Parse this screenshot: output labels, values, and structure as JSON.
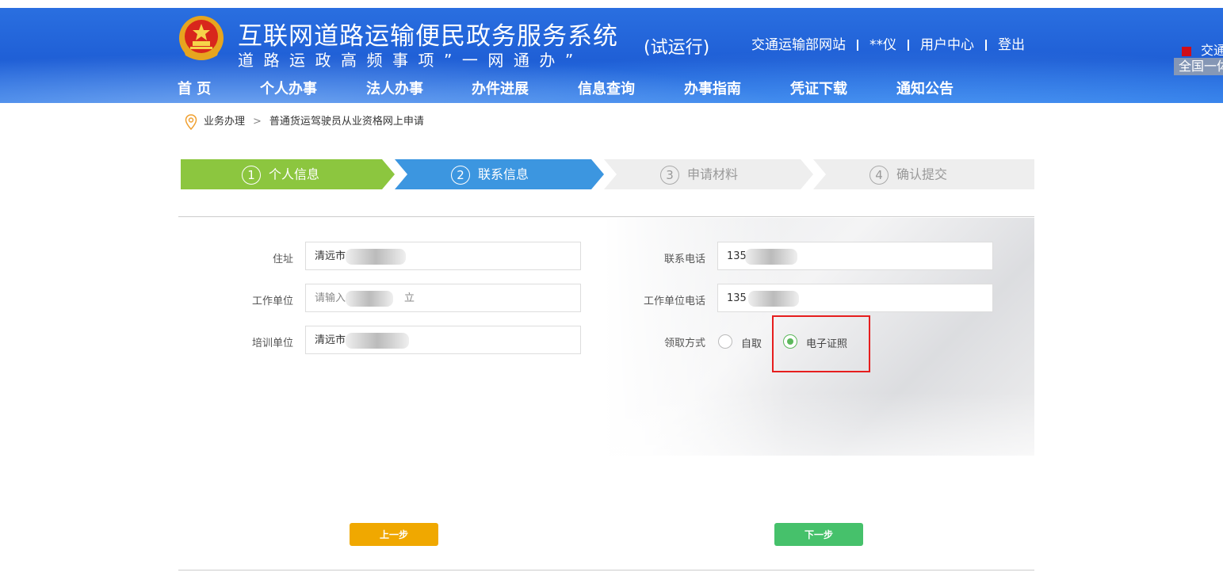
{
  "header": {
    "title": "互联网道路运输便民政务服务系统",
    "subtitle": "道路运政高频事项”一网通办”",
    "trial": "(试运行)",
    "links": [
      "交通运输部网站",
      "**仪",
      "用户中心",
      "登出"
    ],
    "corner_text": "交通",
    "corner_sub": "全国一体"
  },
  "nav": {
    "items": [
      "首 页",
      "个人办事",
      "法人办事",
      "办件进展",
      "信息查询",
      "办事指南",
      "凭证下载",
      "通知公告"
    ],
    "active": "个人办事"
  },
  "breadcrumb": {
    "root": "业务办理",
    "separator": ">",
    "current": "普通货运驾驶员从业资格网上申请"
  },
  "steps": [
    {
      "num": "1",
      "label": "个人信息",
      "state": "done",
      "color": "#8cc63f"
    },
    {
      "num": "2",
      "label": "联系信息",
      "state": "active",
      "color": "#3c96e0"
    },
    {
      "num": "3",
      "label": "申请材料",
      "state": "pending",
      "color": "#eeeeee"
    },
    {
      "num": "4",
      "label": "确认提交",
      "state": "pending",
      "color": "#eeeeee"
    }
  ],
  "form": {
    "address": {
      "label": "住址",
      "value": "清远市"
    },
    "workplace": {
      "label": "工作单位",
      "value": "请输入",
      "suffix": "立"
    },
    "training": {
      "label": "培训单位",
      "value": "清远市"
    },
    "phone": {
      "label": "联系电话",
      "value": "135"
    },
    "work_phone": {
      "label": "工作单位电话",
      "value": "135"
    },
    "pickup": {
      "label": "领取方式",
      "options": [
        "自取",
        "电子证照"
      ],
      "selected": "电子证照"
    }
  },
  "buttons": {
    "prev": {
      "label": "上一步",
      "color": "#f0a800"
    },
    "next": {
      "label": "下一步",
      "color": "#46c16b"
    }
  }
}
